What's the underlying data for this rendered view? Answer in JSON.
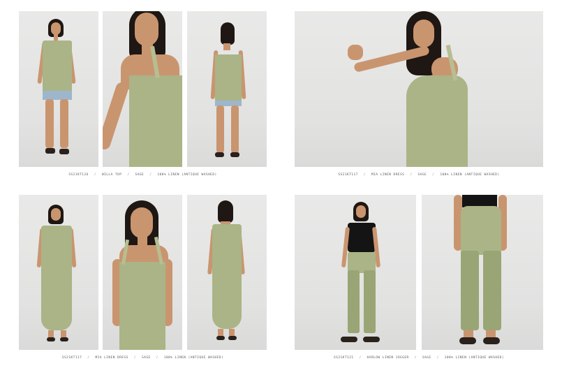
{
  "captions": {
    "row1_left": {
      "sku": "SS21KT126",
      "name": "WILLA TOP",
      "color": "SAGE",
      "fabric": "100% LINEN (ANTIQUE WASHED)"
    },
    "row1_right": {
      "sku": "SS21KT117",
      "name": "MIA LINEN DRESS",
      "color": "SAGE",
      "fabric": "100% LINEN (ANTIQUE WASHED)"
    },
    "row2_left": {
      "sku": "SS21KT117",
      "name": "MIA LINEN DRESS",
      "color": "SAGE",
      "fabric": "100% LINEN (ANTIQUE WASHED)"
    },
    "row2_right": {
      "sku": "SS21KT121",
      "name": "HARLOW LINEN JOGGER",
      "color": "SAGE",
      "fabric": "100% LINEN (ANTIQUE WASHED)"
    }
  },
  "separator": "/",
  "colors": {
    "background": "#ffffff",
    "photo_backdrop": "#e6e6e5",
    "garment_sage": "#aab486",
    "caption_text": "#5a5a5a"
  }
}
